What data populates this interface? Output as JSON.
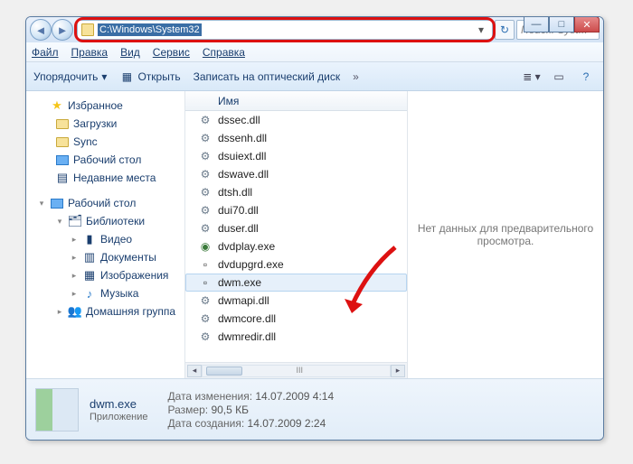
{
  "window": {
    "address_path": "C:\\Windows\\System32",
    "search_placeholder": "Поиск: Syst..."
  },
  "menu": {
    "file": "Файл",
    "edit": "Правка",
    "view": "Вид",
    "tools": "Сервис",
    "help": "Справка"
  },
  "toolbar": {
    "organize": "Упорядочить",
    "open": "Открыть",
    "burn": "Записать на оптический диск"
  },
  "sidebar": {
    "favorites": "Избранное",
    "downloads": "Загрузки",
    "sync": "Sync",
    "desktop": "Рабочий стол",
    "recent": "Недавние места",
    "desktop2": "Рабочий стол",
    "libraries": "Библиотеки",
    "videos": "Видео",
    "documents": "Документы",
    "images": "Изображения",
    "music": "Музыка",
    "homegroup": "Домашняя группа"
  },
  "list": {
    "header_name": "Имя",
    "files": [
      "dssec.dll",
      "dssenh.dll",
      "dsuiext.dll",
      "dswave.dll",
      "dtsh.dll",
      "dui70.dll",
      "duser.dll",
      "dvdplay.exe",
      "dvdupgrd.exe",
      "dwm.exe",
      "dwmapi.dll",
      "dwmcore.dll",
      "dwmredir.dll"
    ],
    "hscroll_label": "III"
  },
  "preview": {
    "empty": "Нет данных для предварительного просмотра."
  },
  "details": {
    "filename": "dwm.exe",
    "filetype": "Приложение",
    "modified_label": "Дата изменения:",
    "modified_value": "14.07.2009 4:14",
    "size_label": "Размер:",
    "size_value": "90,5 КБ",
    "created_label": "Дата создания:",
    "created_value": "14.07.2009 2:24"
  }
}
